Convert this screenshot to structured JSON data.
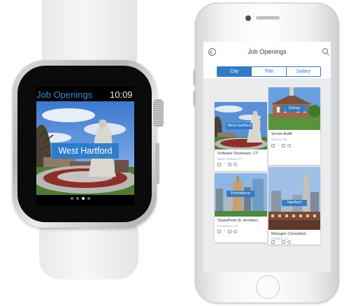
{
  "watch": {
    "title": "Job Openings",
    "time": "10:09",
    "location": "West Hartford",
    "pages": 4,
    "active_page": 2
  },
  "phone": {
    "title": "Job Openings",
    "tabs": [
      {
        "label": "City",
        "active": true
      },
      {
        "label": "Title",
        "active": false
      },
      {
        "label": "Salary",
        "active": false
      }
    ],
    "cards": [
      {
        "city": "West Hartford",
        "title": "Software Developer, CT",
        "subtitle": "West Hartford, CT"
      },
      {
        "city": "Quincy",
        "title": "Senior Audit",
        "subtitle": "Quincy, MA"
      },
      {
        "city": "Providence",
        "title": "SharePoint Sr. Architect",
        "subtitle": "Providence, RI"
      },
      {
        "city": "Hartford",
        "title": "Manager Consultant",
        "subtitle": "Hartford, CT"
      }
    ]
  },
  "colors": {
    "accent": "#2f7cc4",
    "watch_title": "#3f8bd8"
  }
}
